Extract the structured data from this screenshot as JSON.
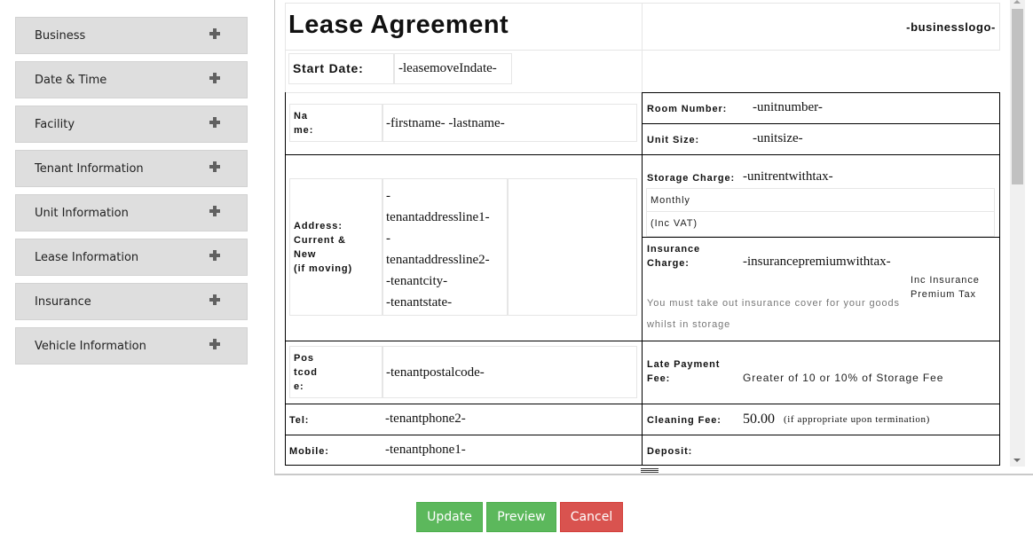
{
  "sidebar": {
    "items": [
      {
        "label": "Business",
        "icon": "plus-icon"
      },
      {
        "label": "Date & Time",
        "icon": "plus-icon"
      },
      {
        "label": "Facility",
        "icon": "plus-icon"
      },
      {
        "label": "Tenant Information",
        "icon": "plus-icon"
      },
      {
        "label": "Unit Information",
        "icon": "plus-icon"
      },
      {
        "label": "Lease Information",
        "icon": "plus-icon"
      },
      {
        "label": "Insurance",
        "icon": "plus-icon"
      },
      {
        "label": "Vehicle Information",
        "icon": "plus-icon"
      }
    ]
  },
  "document": {
    "title": "Lease Agreement",
    "logo_placeholder": "-businesslogo-",
    "start_date_label": "Start Date:",
    "start_date_value": "-leasemoveIndate-",
    "name_label_1": "Na",
    "name_label_2": "me:",
    "name_value": "-firstname-  -lastname-",
    "address_label": [
      "Address:",
      "Current &",
      "New",
      "(if moving)"
    ],
    "address_values": [
      "-",
      "tenantaddressline1-",
      "-",
      "tenantaddressline2-",
      "-tenantcity-",
      "-tenantstate-"
    ],
    "postcode_label": [
      "Pos",
      "tcod",
      "e:"
    ],
    "postcode_value": "-tenantpostalcode-",
    "tel_label": "Tel:",
    "tel_value": "-tenantphone2-",
    "mobile_label": "Mobile:",
    "mobile_value": "-tenantphone1-",
    "room_number_label": "Room Number:",
    "room_number_value": "-unitnumber-",
    "unit_size_label": "Unit Size:",
    "unit_size_value": "-unitsize-",
    "storage_charge_label": "Storage Charge:",
    "storage_charge_value": "-unitrentwithtax-",
    "storage_period": "Monthly",
    "storage_vat_note": "(Inc VAT)",
    "insurance_label_1": "Insurance",
    "insurance_label_2": "Charge:",
    "insurance_value": "-insurancepremiumwithtax-",
    "insurance_tax_note_1": "Inc Insurance",
    "insurance_tax_note_2": "Premium Tax",
    "insurance_notice_1": "You must take out insurance cover for your goods",
    "insurance_notice_2": "whilst in storage",
    "late_fee_label_1": "Late Payment",
    "late_fee_label_2": "Fee:",
    "late_fee_value": "Greater of 10 or 10% of Storage Fee",
    "cleaning_fee_label": "Cleaning Fee:",
    "cleaning_fee_value": "50.00",
    "cleaning_fee_note": "(if appropriate upon termination)",
    "deposit_label": "Deposit:"
  },
  "actions": {
    "update_label": "Update",
    "preview_label": "Preview",
    "cancel_label": "Cancel"
  },
  "colors": {
    "accordion_bg": "#dedede",
    "success": "#5cb85c",
    "danger": "#d9534f"
  }
}
